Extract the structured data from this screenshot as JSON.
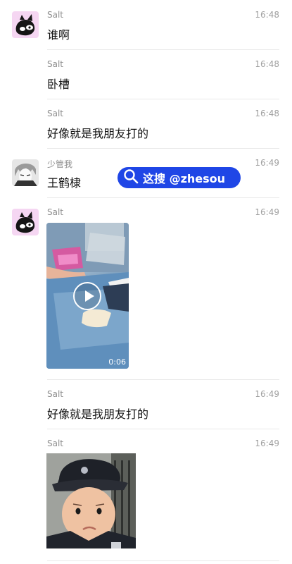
{
  "messages": [
    {
      "name": "Salt",
      "time": "16:48",
      "text": "谁啊"
    },
    {
      "name": "Salt",
      "time": "16:48",
      "text": "卧槽"
    },
    {
      "name": "Salt",
      "time": "16:48",
      "text": "好像就是我朋友打的"
    },
    {
      "name": "少管我",
      "time": "16:49",
      "text": "王鹤棣"
    },
    {
      "name": "Salt",
      "time": "16:49",
      "video_duration": "0:06"
    },
    {
      "name": "Salt",
      "time": "16:49",
      "text": "好像就是我朋友打的"
    },
    {
      "name": "Salt",
      "time": "16:49"
    }
  ],
  "watermark": {
    "text": "这搜 @zhesou"
  }
}
